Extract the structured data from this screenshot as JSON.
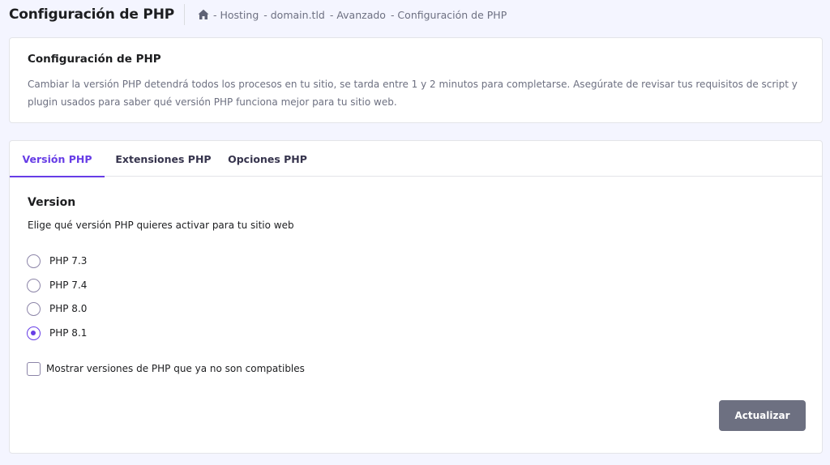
{
  "header": {
    "title": "Configuración de PHP",
    "breadcrumb": [
      "- Hosting",
      "- domain.tld",
      "- Avanzado",
      "- Configuración de PHP"
    ]
  },
  "info_card": {
    "title": "Configuración de PHP",
    "description": "Cambiar la versión PHP detendrá todos los procesos en tu sitio, se tarda entre 1 y 2 minutos para completarse. Asegúrate de revisar tus requisitos de script y plugin usados para saber qué versión PHP funciona mejor para tu sitio web."
  },
  "tabs": [
    {
      "label": "Versión PHP",
      "active": true
    },
    {
      "label": "Extensiones PHP",
      "active": false
    },
    {
      "label": "Opciones PHP",
      "active": false
    }
  ],
  "version_section": {
    "title": "Version",
    "description": "Elige qué versión PHP quieres activar para tu sitio web",
    "options": [
      {
        "label": "PHP 7.3",
        "selected": false
      },
      {
        "label": "PHP 7.4",
        "selected": false
      },
      {
        "label": "PHP 8.0",
        "selected": false
      },
      {
        "label": "PHP 8.1",
        "selected": true
      }
    ],
    "show_deprecated_label": "Mostrar versiones de PHP que ya no son compatibles",
    "show_deprecated_checked": false
  },
  "actions": {
    "update_label": "Actualizar"
  },
  "colors": {
    "accent": "#673de6",
    "button_disabled": "#6d7081",
    "background": "#f4f5ff"
  },
  "icons": {
    "home": "home-icon"
  }
}
